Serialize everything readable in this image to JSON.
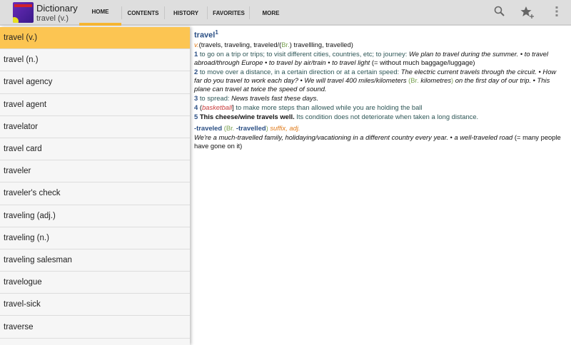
{
  "app": {
    "title": "Dictionary",
    "subtitle": "travel (v.)"
  },
  "tabs": [
    {
      "label": "HOME",
      "active": true
    },
    {
      "label": "CONTENTS"
    },
    {
      "label": "HISTORY"
    },
    {
      "label": "FAVORITES"
    },
    {
      "label": "MORE"
    }
  ],
  "icons": [
    "search-icon",
    "add-favorite-icon",
    "overflow-menu-icon"
  ],
  "sidebar": {
    "selected": 0,
    "items": [
      "travel (v.)",
      "travel (n.)",
      "travel agency",
      "travel agent",
      "travelator",
      "travel card",
      "traveler",
      "traveler's check",
      "traveling (adj.)",
      "traveling (n.)",
      "traveling salesman",
      "travelogue",
      "travel-sick",
      "traverse"
    ]
  },
  "entry": {
    "headword": "travel",
    "homograph": "1",
    "lines": [
      [
        [
          "or",
          "v."
        ],
        [
          "",
          "(travels, traveling, traveled/("
        ],
        [
          "gr",
          "Br."
        ],
        [
          "",
          ") travellling, travelled)"
        ]
      ],
      [
        [
          "num",
          "1"
        ],
        [
          "def",
          " to go on a trip or trips; to visit different cities, countries, etc; to journey: "
        ],
        [
          "ex",
          "We plan to travel during the summer. • to travel abroad/through Europe • to travel by air/train • to travel light"
        ],
        [
          "",
          " (= without much baggage/luggage)"
        ]
      ],
      [
        [
          "num",
          "2"
        ],
        [
          "def",
          " to move over a distance, in a certain direction or at a certain speed: "
        ],
        [
          "ex",
          "The electric current travels through the circuit. • How far do you travel to work each day? • We will travel 400 miles/kilometers "
        ],
        [
          "gr",
          "(Br. "
        ],
        [
          "ex",
          "kilometres"
        ],
        [
          "gr",
          ")"
        ],
        [
          "ex",
          " on the first day of our trip. • This plane can travel at twice the speed of sound."
        ]
      ],
      [
        [
          "num",
          "3"
        ],
        [
          "def",
          " to spread: "
        ],
        [
          "ex",
          "News travels fast these days."
        ]
      ],
      [
        [
          "num",
          "4"
        ],
        [
          "",
          " ("
        ],
        [
          "red",
          "basketball"
        ],
        [
          "",
          "]"
        ],
        [
          "def",
          " to make more steps than allowed while you are holding the ball"
        ]
      ],
      [
        [
          "num",
          "5"
        ],
        [
          "bold",
          " This cheese/wine travels well."
        ],
        [
          "def",
          " Its condition does not deteriorate when taken a long distance."
        ]
      ]
    ],
    "derivative": [
      [
        [
          "bl",
          "-traveled"
        ],
        [
          "gr",
          " (Br. "
        ],
        [
          "bl",
          "-travelled"
        ],
        [
          "gr",
          ") "
        ],
        [
          "or",
          "suffix, adj."
        ]
      ],
      [
        [
          "ex",
          "We're a much-travelled family, holidaying/vacationing in a different country every year. • a well-traveled road"
        ],
        [
          "",
          " (= many people have gone on it)"
        ]
      ]
    ]
  }
}
